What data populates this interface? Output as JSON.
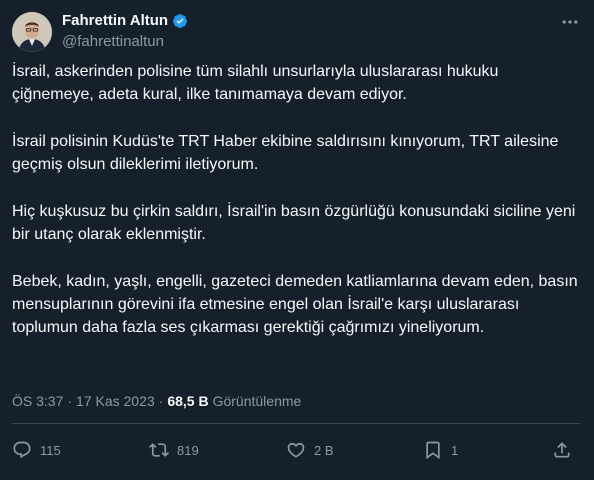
{
  "author": {
    "display_name": "Fahrettin Altun",
    "handle": "@fahrettinaltun"
  },
  "tweet": {
    "paragraphs": [
      "İsrail, askerinden polisine tüm silahlı unsurlarıyla uluslararası hukuku çiğnemeye, adeta kural, ilke tanımamaya devam ediyor.",
      "İsrail polisinin Kudüs'te TRT Haber ekibine saldırısını kınıyorum, TRT ailesine geçmiş olsun dileklerimi iletiyorum.",
      "Hiç kuşkusuz bu çirkin saldırı, İsrail'in basın özgürlüğü konusundaki siciline yeni bir utanç olarak eklenmiştir.",
      "Bebek, kadın, yaşlı, engelli, gazeteci demeden katliamlarına devam eden, basın mensuplarının görevini ifa etmesine engel olan İsrail'e karşı uluslararası toplumun daha fazla ses çıkarması gerektiği çağrımızı yineliyorum."
    ],
    "time": "ÖS 3:37",
    "separator": "·",
    "date": "17 Kas 2023",
    "views_count": "68,5 B",
    "views_label": "Görüntülenme"
  },
  "actions": {
    "replies": "115",
    "reposts": "819",
    "likes": "2 B",
    "bookmarks": "1"
  },
  "colors": {
    "background": "#15202b",
    "text": "#f7f9f9",
    "secondary": "#8b98a5",
    "verified": "#1d9bf0",
    "divider": "#38444d"
  }
}
